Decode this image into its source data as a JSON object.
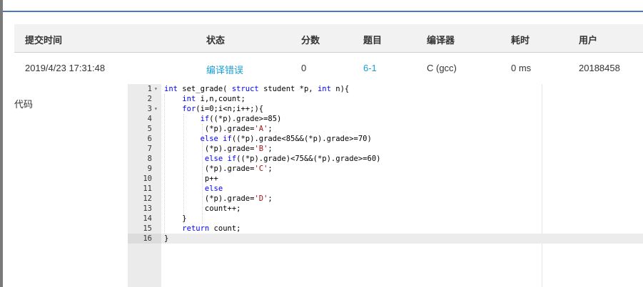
{
  "submission_table": {
    "headers": [
      "提交时间",
      "状态",
      "分数",
      "题目",
      "编译器",
      "耗时",
      "用户"
    ],
    "row": {
      "submit_time": "2019/4/23 17:31:48",
      "status": "编译错误",
      "score": "0",
      "problem": "6-1",
      "compiler": "C (gcc)",
      "time_used": "0 ms",
      "user": "20188458"
    }
  },
  "code_section": {
    "label": "代码",
    "lines": [
      {
        "n": "1",
        "fold": "▾",
        "html": "<span class=\"kw\">int</span> set_grade( <span class=\"kw\">struct</span> student *p, <span class=\"kw\">int</span> n){"
      },
      {
        "n": "2",
        "fold": "",
        "html": "    <span class=\"kw\">int</span> i,n,count;"
      },
      {
        "n": "3",
        "fold": "▾",
        "html": "    <span class=\"kw\">for</span>(i=0;i&lt;n;i++;){"
      },
      {
        "n": "4",
        "fold": "",
        "html": "        <span class=\"kw\">if</span>((*p).grade&gt;=85)"
      },
      {
        "n": "5",
        "fold": "",
        "html": "         (*p).grade=<span class=\"str\">'A'</span>;"
      },
      {
        "n": "6",
        "fold": "",
        "html": "        <span class=\"kw\">else if</span>((*p).grade&lt;85&amp;&amp;(*p).grade&gt;=70)"
      },
      {
        "n": "7",
        "fold": "",
        "html": "         (*p).grade=<span class=\"str\">'B'</span>;"
      },
      {
        "n": "8",
        "fold": "",
        "html": "         <span class=\"kw\">else if</span>((*p).grade)&lt;75&amp;&amp;(*p).grade&gt;=60)"
      },
      {
        "n": "9",
        "fold": "",
        "html": "         (*p).grade=<span class=\"str\">'C'</span>;"
      },
      {
        "n": "10",
        "fold": "",
        "html": "         p++"
      },
      {
        "n": "11",
        "fold": "",
        "html": "         <span class=\"kw\">else</span>"
      },
      {
        "n": "12",
        "fold": "",
        "html": "         (*p).grade=<span class=\"str\">'D'</span>;"
      },
      {
        "n": "13",
        "fold": "",
        "html": "         count++;"
      },
      {
        "n": "14",
        "fold": "",
        "html": "    }"
      },
      {
        "n": "15",
        "fold": "",
        "html": "    <span class=\"kw\">return</span> count;"
      },
      {
        "n": "16",
        "fold": "",
        "html": "}"
      }
    ],
    "active_line": "16"
  },
  "colors": {
    "accent_top_line": "#4a74c9",
    "link": "#1a9ed6",
    "keyword": "#0000ff",
    "string": "#a31515"
  },
  "icons": [
    "fold-arrow-icon"
  ]
}
